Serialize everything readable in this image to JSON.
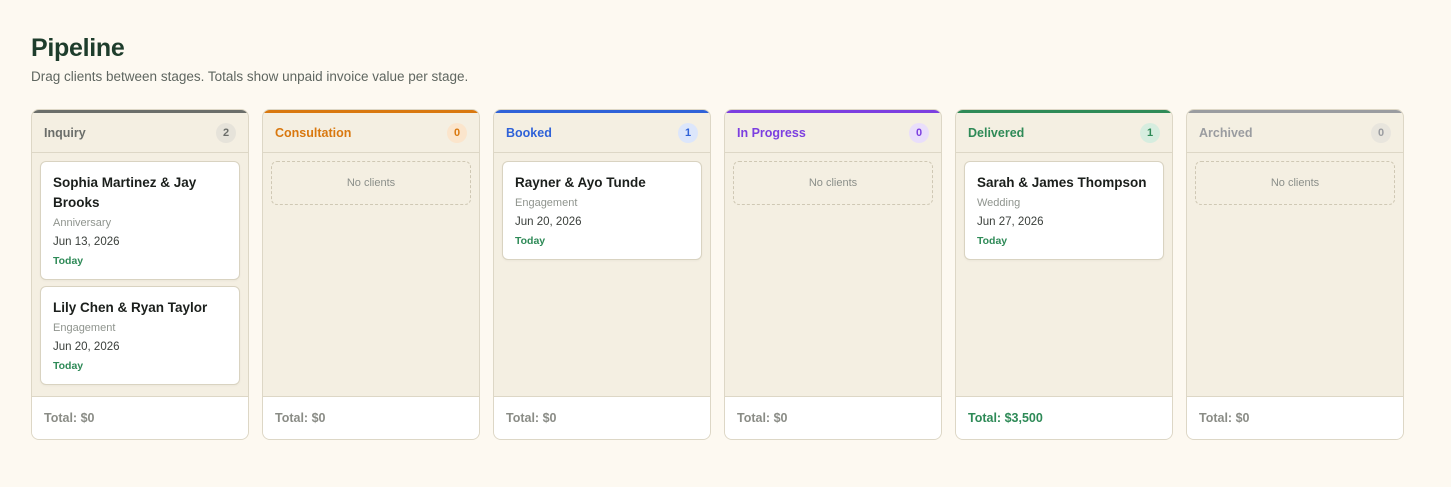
{
  "page": {
    "title": "Pipeline",
    "subtitle": "Drag clients between stages. Totals show unpaid invoice value per stage."
  },
  "colors": {
    "inquiry": "#6b6e6a",
    "consultation": "#d9780f",
    "booked": "#2f62d8",
    "in_progress": "#7c3fe0",
    "delivered": "#2e8a57",
    "archived": "#9a9ca0"
  },
  "columns": [
    {
      "title": "Inquiry",
      "count": "2",
      "total": "Total: $0",
      "cards": [
        {
          "name": "Sophia Martinez & Jay Brooks",
          "type": "Anniversary",
          "date": "Jun 13, 2026",
          "flag": "Today"
        },
        {
          "name": "Lily Chen & Ryan Taylor",
          "type": "Engagement",
          "date": "Jun 20, 2026",
          "flag": "Today"
        }
      ]
    },
    {
      "title": "Consultation",
      "count": "0",
      "total": "Total: $0",
      "empty": "No clients"
    },
    {
      "title": "Booked",
      "count": "1",
      "total": "Total: $0",
      "cards": [
        {
          "name": "Rayner & Ayo Tunde",
          "type": "Engagement",
          "date": "Jun 20, 2026",
          "flag": "Today"
        }
      ]
    },
    {
      "title": "In Progress",
      "count": "0",
      "total": "Total: $0",
      "empty": "No clients"
    },
    {
      "title": "Delivered",
      "count": "1",
      "total": "Total: $3,500",
      "cards": [
        {
          "name": "Sarah & James Thompson",
          "type": "Wedding",
          "date": "Jun 27, 2026",
          "flag": "Today"
        }
      ]
    },
    {
      "title": "Archived",
      "count": "0",
      "total": "Total: $0",
      "empty": "No clients"
    }
  ]
}
